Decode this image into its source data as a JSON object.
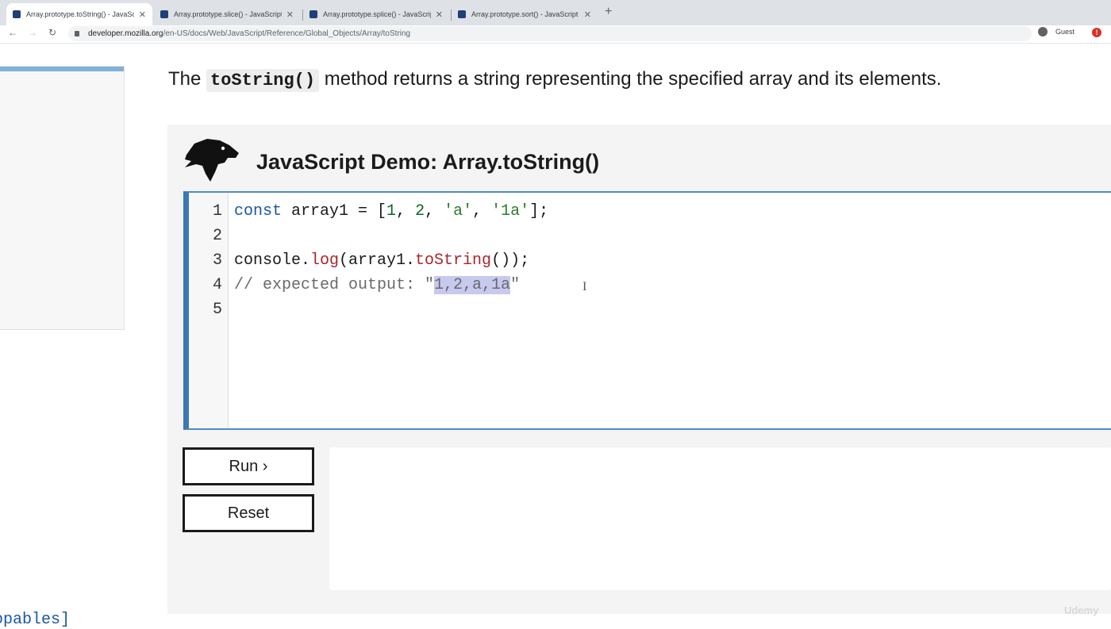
{
  "browser": {
    "tabs": [
      {
        "label": "Array.prototype.toString() - JavaScript | MDN",
        "active": true
      },
      {
        "label": "Array.prototype.slice() - JavaScript | MDN",
        "active": false
      },
      {
        "label": "Array.prototype.splice() - JavaScript | MDN",
        "active": false
      },
      {
        "label": "Array.prototype.sort() - JavaScript | MDN",
        "active": false
      }
    ],
    "url_domain": "developer.mozilla.org",
    "url_path": "/en-US/docs/Web/JavaScript/Reference/Global_Objects/Array/toString",
    "profile_label": "Guest"
  },
  "page": {
    "intro_before": "The ",
    "intro_code": "toString()",
    "intro_after": " method returns a string representing the specified array and its elements.",
    "demo_title": "JavaScript Demo: Array.toString()",
    "line_numbers": [
      "1",
      "2",
      "3",
      "4",
      "5"
    ],
    "code": {
      "l1_kw": "const",
      "l1_var": " array1 = [",
      "l1_n1": "1",
      "l1_c1": ", ",
      "l1_n2": "2",
      "l1_c2": ", ",
      "l1_s1": "'a'",
      "l1_c3": ", ",
      "l1_s2": "'1a'",
      "l1_end": "];",
      "l3_obj": "console.",
      "l3_fn": "log",
      "l3_mid": "(array1.",
      "l3_fn2": "toString",
      "l3_end": "());",
      "l4_cmt": "// expected output: \"",
      "l4_hl": "1,2,a,1a",
      "l4_end": "\""
    },
    "run_button": "Run ›",
    "reset_button": "Reset",
    "bottom_fragment": "opables]",
    "watermark": "Udemy"
  },
  "colors": {
    "editor_accent": "#3b79b3",
    "keyword": "#1a56a6",
    "string": "#2a7d2a",
    "function": "#a8262d",
    "selection": "#c7c9ee"
  }
}
